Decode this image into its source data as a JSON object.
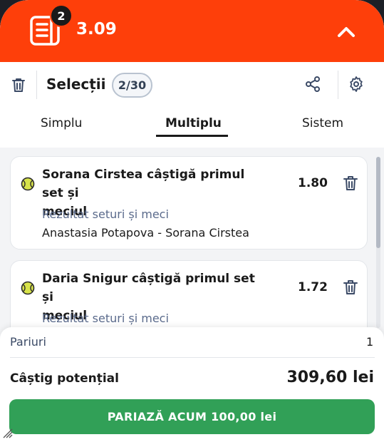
{
  "header": {
    "badge_count": "2",
    "total_odds": "3.09",
    "icons": {
      "betslip": "betslip-icon",
      "collapse": "chevron-up-icon"
    },
    "color": "#fe3f0a"
  },
  "toolbar": {
    "title": "Selecții",
    "count": "2/30",
    "icons": {
      "clear": "trash-icon",
      "share": "share-icon",
      "settings": "gear-icon"
    }
  },
  "tabs": [
    {
      "label": "Simplu",
      "active": false
    },
    {
      "label": "Multiplu",
      "active": true
    },
    {
      "label": "Sistem",
      "active": false
    }
  ],
  "selections": [
    {
      "name_line1": "Sorana Cirstea câștigă primul set și",
      "name_line2": "meciul",
      "odds": "1.80",
      "market": "Rezultat seturi și meci",
      "event": "Anastasia Potapova - Sorana Cirstea",
      "sport_icon": "tennis-ball-icon"
    },
    {
      "name_line1": "Daria Snigur câștigă primul set și",
      "name_line2": "meciul",
      "odds": "1.72",
      "market": "Rezultat seturi și meci",
      "event": "",
      "sport_icon": "tennis-ball-icon"
    }
  ],
  "footer": {
    "bets_label": "Pariuri",
    "bets_value": "1",
    "potential_win_label": "Câștig potențial",
    "potential_win_value": "309,60 lei",
    "place_bet_label": "PARIAZĂ ACUM 100,00 lei",
    "button_color": "#31a057"
  }
}
